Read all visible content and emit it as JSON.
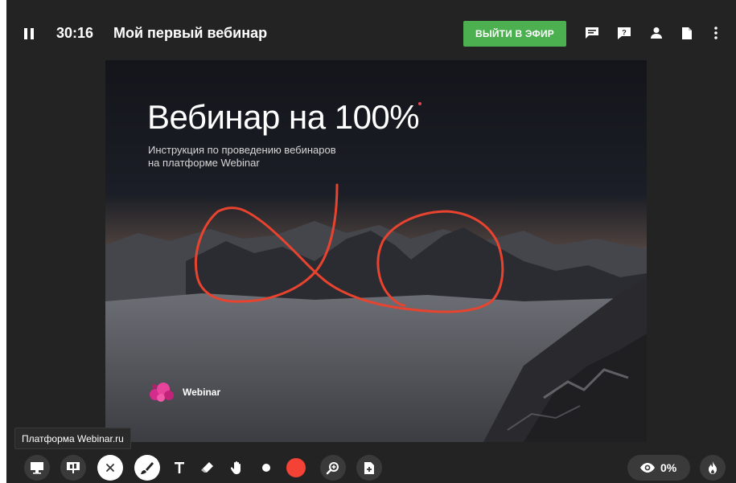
{
  "header": {
    "time": "30:16",
    "title": "Мой первый вебинар",
    "go_live_label": "ВЫЙТИ В ЭФИР"
  },
  "header_icons": [
    "chat-icon",
    "question-icon",
    "person-icon",
    "document-icon",
    "more-vertical-icon"
  ],
  "slide": {
    "title": "Вебинар на 100%",
    "subtitle_line1": "Инструкция по проведению вебинаров",
    "subtitle_line2": "на платформе Webinar",
    "brand_name": "Webinar",
    "accent_color": "#e8434f",
    "annotation_color": "#e8432f"
  },
  "tooltip": "Платформа Webinar.ru",
  "toolbar": {
    "left_tools": [
      "monitor-icon",
      "presentation-icon",
      "close-icon",
      "brush-icon",
      "text-icon",
      "eraser-icon",
      "hand-icon",
      "dot-size-icon",
      "color-swatch",
      "zoom-icon",
      "add-file-icon"
    ],
    "selected_color": "#f44336",
    "viewers_percent": "0%",
    "fire_icon": "flame-icon"
  },
  "colors": {
    "go_live_bg": "#4caf50",
    "background": "#232323"
  }
}
